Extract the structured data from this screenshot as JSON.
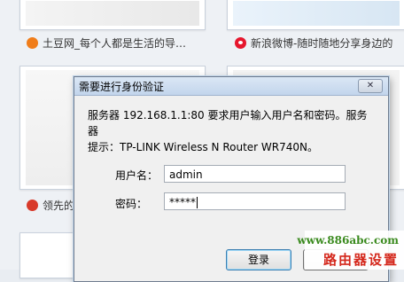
{
  "background": {
    "sites": [
      {
        "label": "土豆网_每个人都是生活的导…",
        "icon": "tudou-icon"
      },
      {
        "label": "新浪微博-随时随地分享身边的",
        "icon": "weibo-icon"
      },
      {
        "label": "领先的",
        "icon": "lingxian-icon"
      }
    ]
  },
  "dialog": {
    "title": "需要进行身份验证",
    "close_label": "✕",
    "message_line1": "服务器 192.168.1.1:80 要求用户输入用户名和密码。服务器",
    "message_line2": "提示：TP-LINK Wireless N Router WR740N。",
    "username_label": "用户名：",
    "username_value": "admin",
    "password_label": "密码：",
    "password_value": "*****",
    "login_label": "登录"
  },
  "watermark": {
    "url": "www.886abc.com",
    "name": "路由器设置"
  }
}
